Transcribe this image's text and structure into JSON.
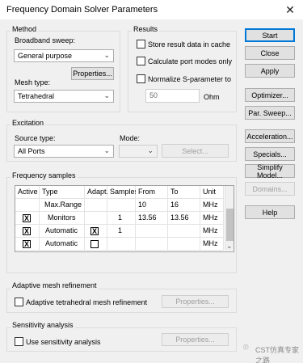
{
  "window": {
    "title": "Frequency Domain Solver Parameters",
    "close_glyph": "✕"
  },
  "method": {
    "group_label": "Method",
    "broadband_label": "Broadband sweep:",
    "broadband_value": "General purpose",
    "properties_label": "Properties...",
    "mesh_type_label": "Mesh type:",
    "mesh_type_value": "Tetrahedral"
  },
  "results": {
    "group_label": "Results",
    "store_label": "Store result data in cache",
    "calc_label": "Calculate port modes only",
    "normalize_label": "Normalize S-parameter to",
    "impedance_value": "50",
    "impedance_unit": "Ohm"
  },
  "excitation": {
    "group_label": "Excitation",
    "source_label": "Source type:",
    "source_value": "All Ports",
    "mode_label": "Mode:",
    "mode_value": "",
    "select_label": "Select..."
  },
  "freq": {
    "group_label": "Frequency samples",
    "columns": [
      "Active",
      "Type",
      "Adapt.",
      "Samples",
      "From",
      "To",
      "Unit"
    ],
    "rows": [
      {
        "active": "",
        "type": "Max.Range",
        "adapt": "",
        "samples": "",
        "from": "10",
        "to": "16",
        "unit": "MHz"
      },
      {
        "active": "X",
        "type": "Monitors",
        "adapt": "",
        "samples": "1",
        "from": "13.56",
        "to": "13.56",
        "unit": "MHz"
      },
      {
        "active": "X",
        "type": "Automatic",
        "adapt": "X",
        "samples": "1",
        "from": "",
        "to": "",
        "unit": "MHz"
      },
      {
        "active": "X",
        "type": "Automatic",
        "adapt": "",
        "samples": "",
        "from": "",
        "to": "",
        "unit": "MHz"
      }
    ]
  },
  "adaptive": {
    "group_label": "Adaptive mesh refinement",
    "check_label": "Adaptive tetrahedral mesh refinement",
    "properties_label": "Properties..."
  },
  "sensitivity": {
    "group_label": "Sensitivity analysis",
    "check_label": "Use sensitivity analysis",
    "properties_label": "Properties..."
  },
  "buttons": {
    "start": "Start",
    "close": "Close",
    "apply": "Apply",
    "optimizer": "Optimizer...",
    "par_sweep": "Par. Sweep...",
    "acceleration": "Acceleration...",
    "specials": "Specials...",
    "simplify": "Simplify Model...",
    "domains": "Domains...",
    "help": "Help"
  },
  "watermark": "CST仿真专家之路"
}
